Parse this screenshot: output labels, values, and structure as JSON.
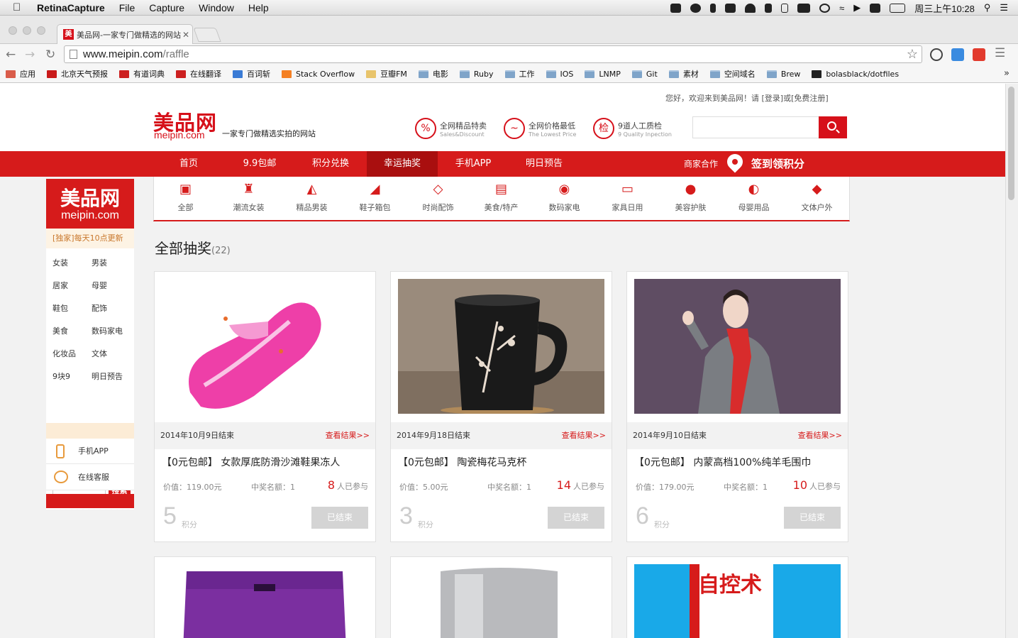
{
  "menubar": {
    "app": "RetinaCapture",
    "items": [
      "File",
      "Capture",
      "Window",
      "Help"
    ],
    "clock": "周三上午10:28"
  },
  "browser": {
    "tab_title": "美品网-一家专门做精选的网站",
    "url_host": "www.meipin.com",
    "url_path": "/raffle",
    "bookmarks": [
      {
        "label": "应用",
        "color": "#d95c4a"
      },
      {
        "label": "北京天气预报",
        "color": "#c91a1a"
      },
      {
        "label": "有道词典",
        "color": "#cc2020"
      },
      {
        "label": "在线翻译",
        "color": "#cc2020"
      },
      {
        "label": "百词斩",
        "color": "#3a7bd5"
      },
      {
        "label": "Stack Overflow",
        "color": "#f48024"
      },
      {
        "label": "豆瓣FM",
        "color": "#e8c46b"
      },
      {
        "label": "电影",
        "color": "folder"
      },
      {
        "label": "Ruby",
        "color": "folder"
      },
      {
        "label": "工作",
        "color": "folder"
      },
      {
        "label": "IOS",
        "color": "folder"
      },
      {
        "label": "LNMP",
        "color": "folder"
      },
      {
        "label": "Git",
        "color": "folder"
      },
      {
        "label": "素材",
        "color": "folder"
      },
      {
        "label": "空间域名",
        "color": "folder"
      },
      {
        "label": "Brew",
        "color": "folder"
      },
      {
        "label": "bolasblack/dotfiles",
        "color": "#222222"
      }
    ]
  },
  "header": {
    "welcome": "您好，欢迎来到美品网！请 [登录]或[免费注册]",
    "logo": "美品网",
    "logo_sub": "meipin.com",
    "slogan": "一家专门做精选实拍的网站",
    "features": [
      {
        "icon": "tag-icon",
        "glyph": "%",
        "title": "全网精品特卖",
        "sub": "Sales&Discount"
      },
      {
        "icon": "trend-icon",
        "glyph": "~",
        "title": "全网价格最低",
        "sub": "The Lowest Price"
      },
      {
        "icon": "check-icon",
        "glyph": "检",
        "title": "9道人工质检",
        "sub": "9 Quality Inpection"
      }
    ]
  },
  "nav": {
    "items": [
      "首页",
      "9.9包邮",
      "积分兑换",
      "幸运抽奖",
      "手机APP",
      "明日预告"
    ],
    "active_index": 3,
    "merchant": "商家合作",
    "signin": "签到领积分"
  },
  "categories": [
    {
      "label": "全部",
      "glyph": "▣"
    },
    {
      "label": "潮流女装",
      "glyph": "♜"
    },
    {
      "label": "精品男装",
      "glyph": "◭"
    },
    {
      "label": "鞋子箱包",
      "glyph": "◢"
    },
    {
      "label": "时尚配饰",
      "glyph": "◇"
    },
    {
      "label": "美食/特产",
      "glyph": "▤"
    },
    {
      "label": "数码家电",
      "glyph": "◉"
    },
    {
      "label": "家具日用",
      "glyph": "▭"
    },
    {
      "label": "美容护肤",
      "glyph": "●"
    },
    {
      "label": "母婴用品",
      "glyph": "◐"
    },
    {
      "label": "文体户外",
      "glyph": "◆"
    }
  ],
  "sidebar": {
    "logo": "美品网",
    "logo_sub": "meipin.com",
    "notice": "[独家]每天10点更新",
    "links": [
      "女装",
      "男装",
      "居家",
      "母婴",
      "鞋包",
      "配饰",
      "美食",
      "数码家电",
      "化妆品",
      "文体",
      "9块9",
      "明日预告"
    ],
    "search_button": "搜索",
    "mobile_app": "手机APP",
    "support": "在线客服"
  },
  "section": {
    "title": "全部抽奖",
    "count": "(22)"
  },
  "cards": [
    {
      "end": "2014年10月9日结束",
      "result": "查看结果>>",
      "title": "【0元包邮】 女款厚底防滑沙滩鞋果冻人",
      "price": "价值：119.00元",
      "winners": "中奖名额：1",
      "participants": "8",
      "participants_label": "人已参与",
      "points": "5",
      "points_label": "积分",
      "button": "已结束"
    },
    {
      "end": "2014年9月18日结束",
      "result": "查看结果>>",
      "title": "【0元包邮】 陶瓷梅花马克杯",
      "price": "价值：5.00元",
      "winners": "中奖名额：1",
      "participants": "14",
      "participants_label": "人已参与",
      "points": "3",
      "points_label": "积分",
      "button": "已结束"
    },
    {
      "end": "2014年9月10日结束",
      "result": "查看结果>>",
      "title": "【0元包邮】 内蒙高档100%纯羊毛围巾",
      "price": "价值：179.00元",
      "winners": "中奖名额：1",
      "participants": "10",
      "participants_label": "人已参与",
      "points": "6",
      "points_label": "积分",
      "button": "已结束"
    }
  ],
  "more_cards": [
    {
      "image": "purple-underwear-image"
    },
    {
      "image": "silver-device-image"
    },
    {
      "image": "book-cover-image",
      "text": "自控术"
    }
  ]
}
